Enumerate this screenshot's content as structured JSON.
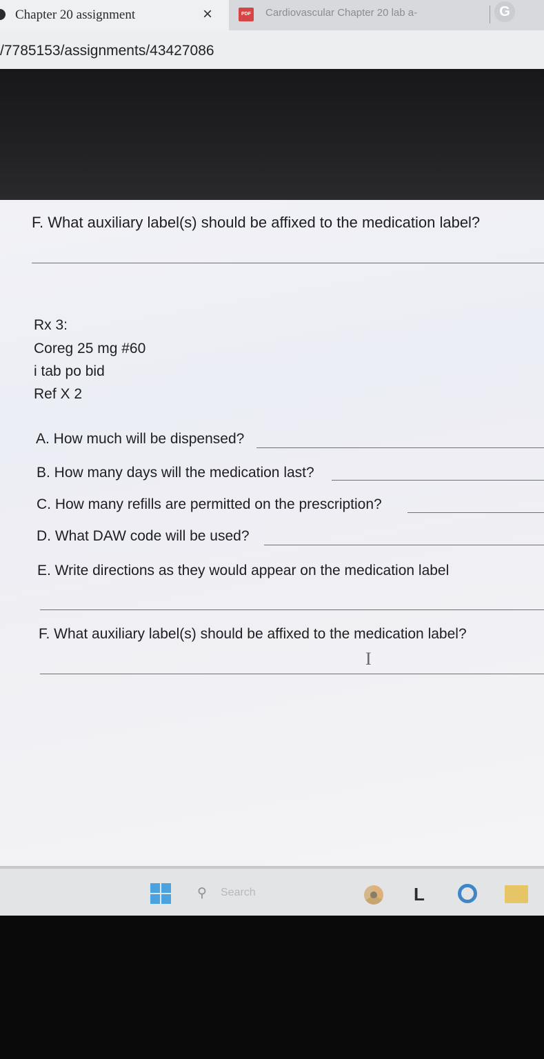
{
  "browser": {
    "active_tab": {
      "title": "Chapter 20 assignment",
      "close": "×"
    },
    "second_tab": {
      "icon_label": "PDF",
      "title": "Cardiovascular Chapter 20 lab a-"
    },
    "google_icon": "G",
    "url": "/7785153/assignments/43427086"
  },
  "document": {
    "prev_question_f": "F. What auxiliary label(s) should be affixed to the medication label?",
    "rx": {
      "heading": "Rx 3:",
      "drug": "Coreg 25 mg #60",
      "sig": "i tab po bid",
      "refills": "Ref X 2"
    },
    "questions": {
      "a": "A. How much will be dispensed?",
      "b": "B. How many days will the medication last?",
      "c": "C. How many refills are permitted on the prescription?",
      "d": "D. What DAW code will be used?",
      "e": "E. Write directions as they would appear on the medication label",
      "f": "F. What auxiliary label(s) should be affixed to the medication label?"
    },
    "cursor": "I"
  },
  "taskbar": {
    "search_placeholder": "Search",
    "search_icon": "⚲",
    "app_l": "L"
  },
  "colors": {
    "windows_blue": "#4aa3df",
    "folder": "#e6c566"
  }
}
